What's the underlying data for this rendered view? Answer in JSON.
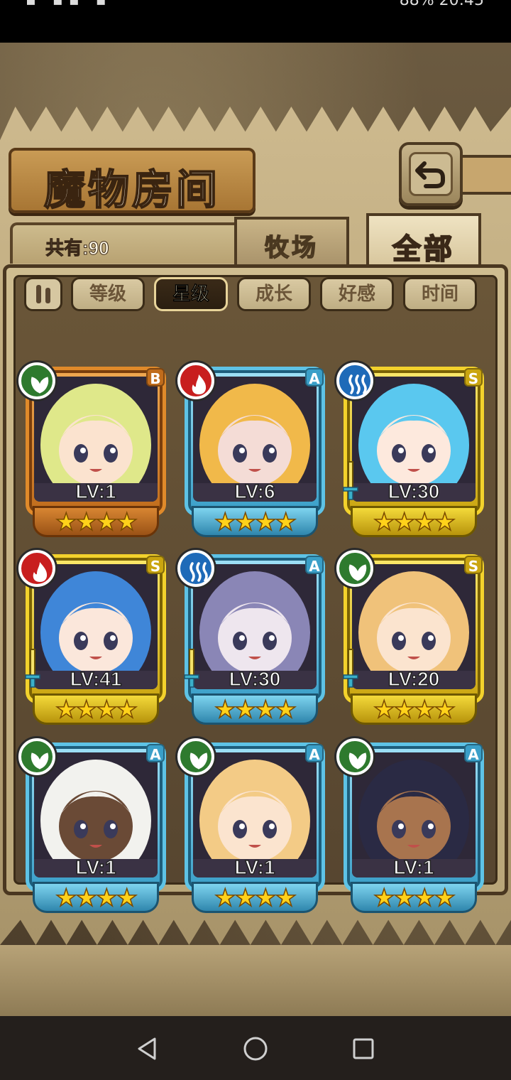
{
  "status_bar": {
    "left": "▪ ▪▪ ▪",
    "right": "88% 20:45"
  },
  "title": "魔物房间",
  "count": {
    "label": "共有:90"
  },
  "top_tabs": [
    {
      "label": "牧场"
    },
    {
      "label": "全部"
    }
  ],
  "filters": [
    {
      "label": "等级"
    },
    {
      "label": "星级"
    },
    {
      "label": "成长"
    },
    {
      "label": "好感"
    },
    {
      "label": "时间"
    }
  ],
  "active_filter": "星级",
  "colors": {
    "grass": "#2e7a2e",
    "fire": "#c81e1e",
    "water": "#1e6ab8",
    "frame_orange": "#e08a2a",
    "frame_blue": "#5ec3e6",
    "frame_gold": "#f3d22c"
  },
  "monsters": [
    {
      "lv": "LV:1",
      "rank": "B",
      "element": "grass",
      "stars": "★★★★",
      "frame": "orange",
      "weapon": false,
      "hair": "#dfe88a",
      "skin": "#fbe3cf"
    },
    {
      "lv": "LV:6",
      "rank": "A",
      "element": "fire",
      "stars": "★★★★",
      "frame": "blue",
      "weapon": false,
      "hair": "#f1b94a",
      "skin": "#f4dcd6"
    },
    {
      "lv": "LV:30",
      "rank": "S",
      "element": "water",
      "stars": "★★★★",
      "frame": "gold",
      "weapon": true,
      "hair": "#5ac8ef",
      "skin": "#fde9dd"
    },
    {
      "lv": "LV:41",
      "rank": "S",
      "element": "fire",
      "stars": "★★★★",
      "frame": "gold",
      "weapon": true,
      "hair": "#3f86d8",
      "skin": "#fbe7db"
    },
    {
      "lv": "LV:30",
      "rank": "A",
      "element": "water",
      "stars": "★★★★",
      "frame": "blue",
      "weapon": true,
      "hair": "#8a86b6",
      "skin": "#eee6ee"
    },
    {
      "lv": "LV:20",
      "rank": "S",
      "element": "grass",
      "stars": "★★★★",
      "frame": "gold",
      "weapon": true,
      "hair": "#f0c27a",
      "skin": "#fbe4cf"
    },
    {
      "lv": "LV:1",
      "rank": "A",
      "element": "grass",
      "stars": "★★★★",
      "frame": "blue",
      "weapon": false,
      "hair": "#f2f2ee",
      "skin": "#6a4a36"
    },
    {
      "lv": "LV:1",
      "rank": "A",
      "element": "grass",
      "stars": "★★★★",
      "frame": "blue",
      "weapon": false,
      "hair": "#f3cb86",
      "skin": "#fbe4cf"
    },
    {
      "lv": "LV:1",
      "rank": "A",
      "element": "grass",
      "stars": "★★★★",
      "frame": "blue",
      "weapon": false,
      "hair": "#2a2a44",
      "skin": "#a8744e"
    }
  ],
  "nav": {
    "back": "back-icon",
    "home": "home-icon",
    "recent": "recent-apps-icon"
  }
}
